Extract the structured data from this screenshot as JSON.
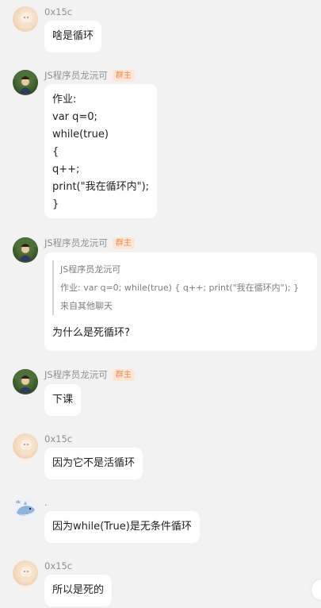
{
  "messages": [
    {
      "sender": "0x15c",
      "avatar": "cream-avatar",
      "badge": "",
      "lines": [
        "啥是循环"
      ]
    },
    {
      "sender": "JS程序员龙沅可",
      "avatar": "green-avatar",
      "badge": "群主",
      "lines": [
        "作业:",
        "var q=0;",
        "while(true)",
        "{",
        "q++;",
        "print(\"我在循环内\");",
        "}"
      ]
    },
    {
      "sender": "JS程序员龙沅可",
      "avatar": "green-avatar",
      "badge": "群主",
      "quote": {
        "author": "JS程序员龙沅可",
        "text": "作业: var q=0; while(true) { q++; print(\"我在循环内\"); }",
        "source": "来自其他聊天"
      },
      "lines": [
        "为什么是死循环?"
      ]
    },
    {
      "sender": "JS程序员龙沅可",
      "avatar": "green-avatar",
      "badge": "群主",
      "lines": [
        "下课"
      ]
    },
    {
      "sender": "0x15c",
      "avatar": "cream-avatar",
      "badge": "",
      "lines": [
        "因为它不是活循环"
      ]
    },
    {
      "sender": ".",
      "avatar": "fish-avatar",
      "badge": "",
      "lines": [
        "因为while(True)是无条件循环"
      ]
    },
    {
      "sender": "0x15c",
      "avatar": "cream-avatar",
      "badge": "",
      "lines": [
        "所以是死的"
      ]
    }
  ]
}
